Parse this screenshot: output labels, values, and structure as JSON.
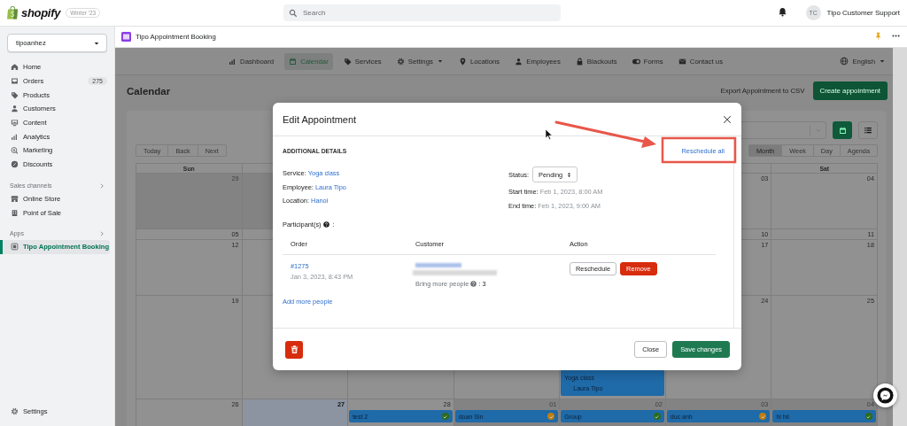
{
  "top_bar": {
    "brand": "shopify",
    "edition": "Winter '23",
    "search": {
      "placeholder": "Search"
    },
    "account": {
      "initials": "TC",
      "name": "Tipo Customer Support"
    }
  },
  "sidebar": {
    "store": "tipoanhez",
    "items": [
      {
        "label": "Home",
        "selected": false
      },
      {
        "label": "Orders",
        "badge": "275",
        "selected": false
      },
      {
        "label": "Products",
        "selected": false
      },
      {
        "label": "Customers",
        "selected": false
      },
      {
        "label": "Content",
        "selected": false
      },
      {
        "label": "Analytics",
        "selected": false
      },
      {
        "label": "Marketing",
        "selected": false
      },
      {
        "label": "Discounts",
        "selected": false
      }
    ],
    "sections": [
      {
        "title": "Sales channels",
        "items": [
          {
            "label": "Online Store",
            "selected": false
          },
          {
            "label": "Point of Sale",
            "selected": false
          }
        ]
      },
      {
        "title": "Apps",
        "items": [
          {
            "label": "Tipo Appointment Booking",
            "selected": true
          }
        ]
      }
    ],
    "settings": "Settings"
  },
  "app_header": {
    "title": "Tipo Appointment Booking"
  },
  "app_nav": {
    "tabs": [
      {
        "label": "Dashboard",
        "selected": false,
        "dropdown": false
      },
      {
        "label": "Calendar",
        "selected": true,
        "dropdown": false
      },
      {
        "label": "Services",
        "selected": false,
        "dropdown": false
      },
      {
        "label": "Settings",
        "selected": false,
        "dropdown": true
      },
      {
        "label": "Locations",
        "selected": false,
        "dropdown": false
      },
      {
        "label": "Employees",
        "selected": false,
        "dropdown": false
      },
      {
        "label": "Blackouts",
        "selected": false,
        "dropdown": false
      },
      {
        "label": "Forms",
        "selected": false,
        "dropdown": false
      },
      {
        "label": "Contact us",
        "selected": false,
        "dropdown": false
      }
    ],
    "language": "English"
  },
  "page": {
    "title": "Calendar",
    "export_link": "Export Appointment to CSV",
    "create_button": "Create appointment"
  },
  "calendar": {
    "nav_buttons": [
      "Today",
      "Back",
      "Next"
    ],
    "views": [
      {
        "label": "Month",
        "selected": true
      },
      {
        "label": "Week",
        "selected": false
      },
      {
        "label": "Day",
        "selected": false
      },
      {
        "label": "Agenda",
        "selected": false
      }
    ],
    "first_weekday": "Sun",
    "last_weekday": "Sat",
    "weeks": [
      {
        "sun": {
          "number": "29",
          "off_range": true,
          "today": false
        },
        "mon": {
          "off_range": true,
          "today": false
        },
        "fri": {
          "number": "03",
          "off_range": false,
          "today": false
        },
        "sat": {
          "number": "04",
          "off_range": false,
          "today": false
        }
      },
      {
        "sun": {
          "number": "05",
          "off_range": false,
          "today": false
        },
        "fri": {
          "number": "10",
          "off_range": false,
          "today": false
        },
        "sat": {
          "number": "11",
          "off_range": false,
          "today": false
        }
      },
      {
        "sun": {
          "number": "12",
          "off_range": false,
          "today": false
        },
        "fri": {
          "number": "17",
          "off_range": false,
          "today": false
        },
        "sat": {
          "number": "18",
          "off_range": false,
          "today": false
        }
      },
      {
        "sun": {
          "number": "19",
          "off_range": false,
          "today": false
        },
        "thu": {
          "events": [
            {
              "title": "Yoga class",
              "employee": "Laura Tipo"
            }
          ]
        },
        "fri": {
          "number": "24",
          "off_range": false,
          "today": false
        },
        "sat": {
          "number": "25",
          "off_range": false,
          "today": false
        }
      },
      {
        "sun": {
          "number": "26",
          "off_range": false,
          "today": false
        },
        "mon": {
          "number": "27",
          "off_range": false,
          "today": true
        },
        "tue": {
          "number": "28",
          "off_range": false,
          "today": false,
          "events": [
            {
              "title": "test 2",
              "color": "#2e6b1c"
            }
          ]
        },
        "wed": {
          "number": "01",
          "off_range": true,
          "today": false,
          "events": [
            {
              "title": "doan Sin",
              "color": "#c07d0e"
            }
          ]
        },
        "thu": {
          "number": "02",
          "off_range": true,
          "today": false,
          "events": [
            {
              "title": "Group",
              "color": "#2e6b1c"
            }
          ]
        },
        "fri": {
          "number": "03",
          "off_range": true,
          "today": false,
          "events": [
            {
              "title": "duc anh",
              "color": "#c07d0e"
            }
          ]
        },
        "sat": {
          "number": "04",
          "off_range": true,
          "today": false,
          "events": [
            {
              "title": "hi hii",
              "color": "#2e6b1c"
            }
          ]
        }
      }
    ]
  },
  "modal": {
    "title": "Edit Appointment",
    "section_title": "ADDITIONAL DETAILS",
    "header_link": "Reschedule all",
    "details": [
      {
        "label": "Service:",
        "value": "Yoga class"
      },
      {
        "label": "Employee:",
        "value": "Laura Tipo"
      },
      {
        "label": "Location:",
        "value": "Hanoi"
      }
    ],
    "status": {
      "label": "Status:",
      "value": "Pending"
    },
    "times": [
      {
        "label": "Start time:",
        "value": "Feb 1, 2023, 8:00 AM"
      },
      {
        "label": "End time:",
        "value": "Feb 1, 2023, 9:00 AM"
      }
    ],
    "participants": {
      "label": "Participant(s)",
      "suffix": ":",
      "columns": [
        "Order",
        "Customer",
        "Action"
      ],
      "rows": [
        {
          "order": "#1275",
          "date": "Jan 3, 2023, 8:43 PM",
          "extra_label": "Bring more people",
          "extra_value": ": 3",
          "actions": [
            {
              "label": "Reschedule",
              "kind": "default"
            },
            {
              "label": "Remove",
              "kind": "danger"
            }
          ]
        }
      ],
      "add_link": "Add more people"
    },
    "footer_buttons": [
      {
        "label": "Close",
        "kind": "default"
      },
      {
        "label": "Save changes",
        "kind": "primary"
      }
    ]
  }
}
